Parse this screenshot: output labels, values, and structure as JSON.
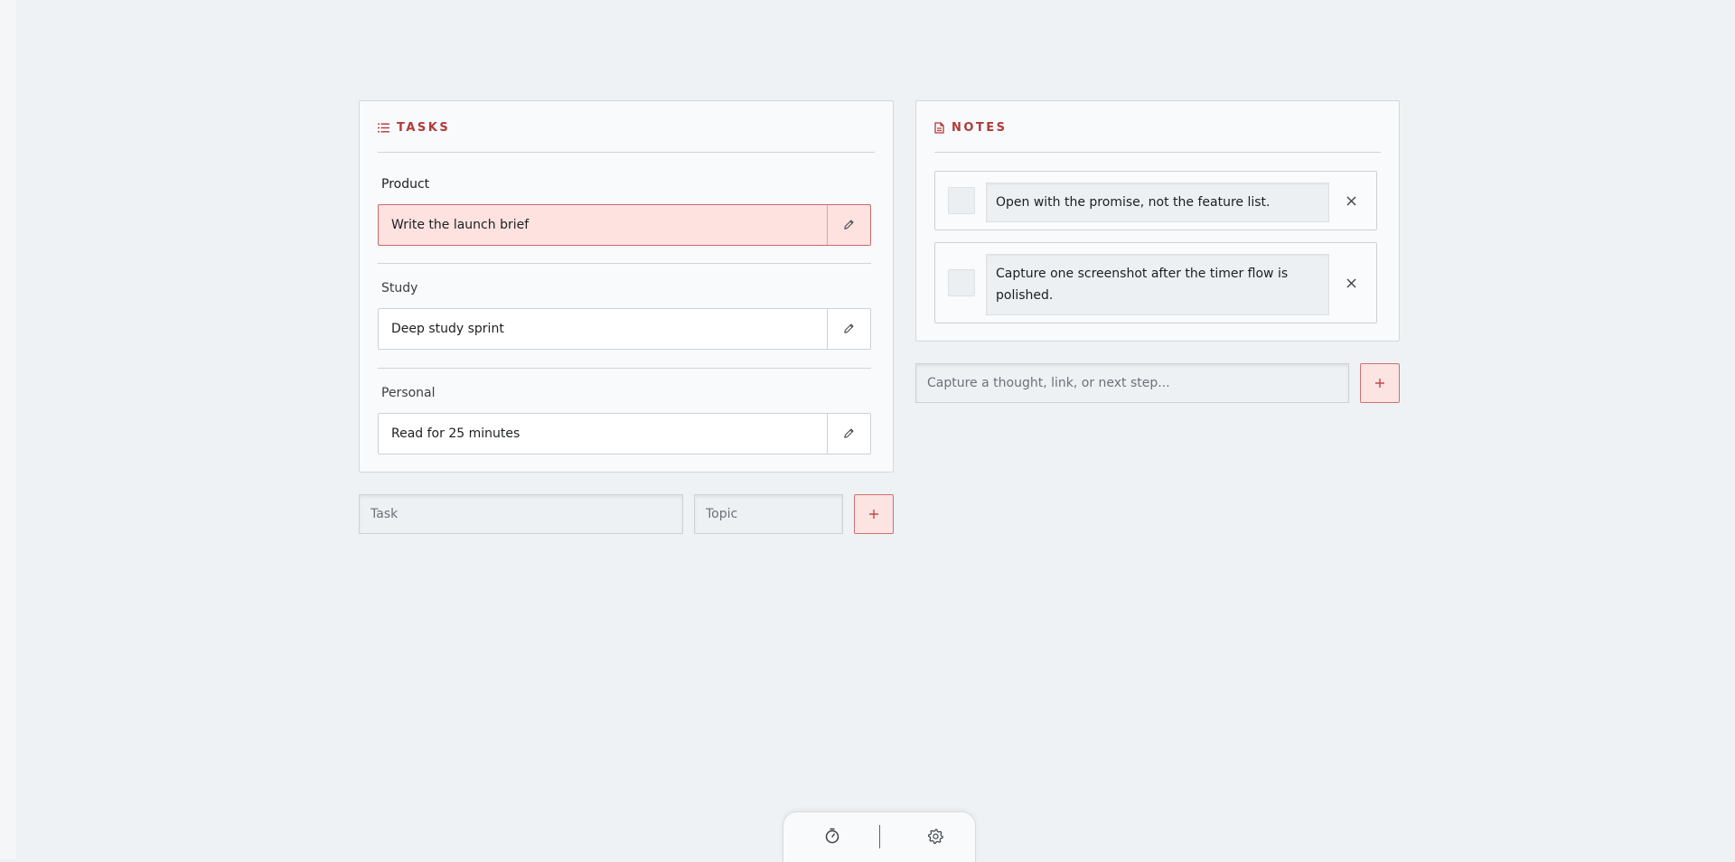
{
  "tasks_panel": {
    "title": "TASKS",
    "groups": [
      {
        "topic": "Product",
        "task": "Write the launch brief",
        "active": true
      },
      {
        "topic": "Study",
        "task": "Deep study sprint",
        "active": false
      },
      {
        "topic": "Personal",
        "task": "Read for 25 minutes",
        "active": false
      }
    ]
  },
  "task_form": {
    "task_placeholder": "Task",
    "topic_placeholder": "Topic",
    "add_label": "+"
  },
  "notes_panel": {
    "title": "NOTES",
    "notes": [
      {
        "text": "Open with the promise, not the feature list.",
        "done": false
      },
      {
        "text": "Capture one screenshot after the timer flow is polished.",
        "done": false
      }
    ]
  },
  "note_form": {
    "placeholder": "Capture a thought, link, or next step...",
    "add_label": "+"
  },
  "dock": {
    "items": [
      "timer-icon",
      "gear-icon"
    ]
  },
  "colors": {
    "accent": "#b13a3a",
    "active_task_bg": "#fde2e0",
    "background": "#eff2f4"
  }
}
